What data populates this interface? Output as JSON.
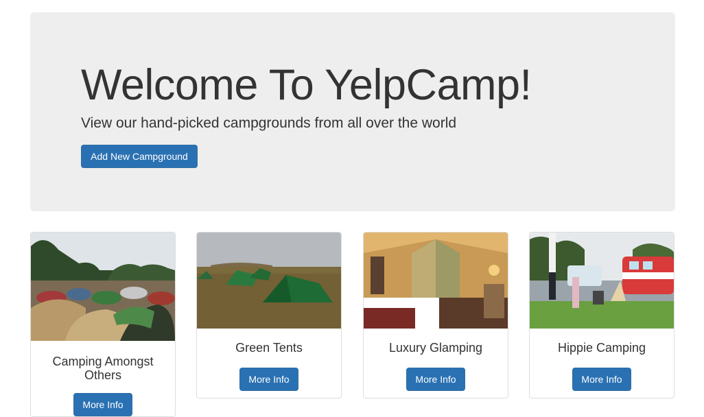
{
  "jumbotron": {
    "title": "Welcome To YelpCamp!",
    "subtitle": "View our hand-picked campgrounds from all over the world",
    "add_button_label": "Add New Campground"
  },
  "campgrounds": [
    {
      "name": "Camping Amongst Others",
      "button_label": "More Info"
    },
    {
      "name": "Green Tents",
      "button_label": "More Info"
    },
    {
      "name": "Luxury Glamping",
      "button_label": "More Info"
    },
    {
      "name": "Hippie Camping",
      "button_label": "More Info"
    }
  ],
  "colors": {
    "jumbotron_bg": "#eeeeee",
    "primary_button": "#2a71b3",
    "text": "#333333"
  }
}
